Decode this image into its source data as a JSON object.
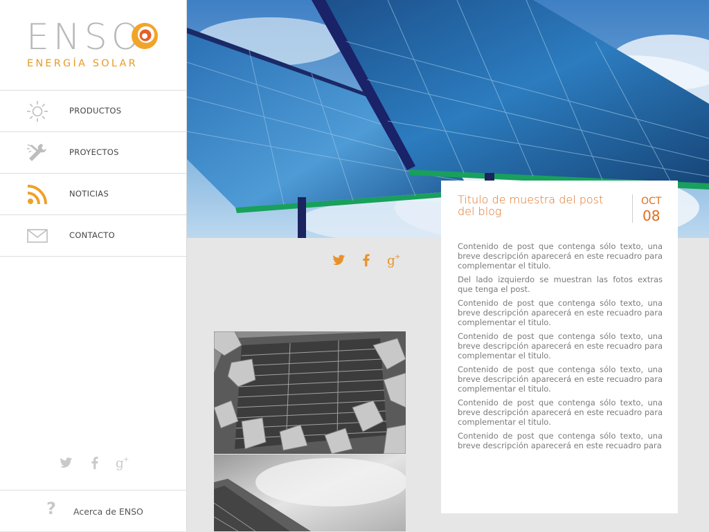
{
  "brand": {
    "name": "ENSO",
    "tagline": "ENERGÍA SOLAR",
    "accent": "#e89a27",
    "accent_dark": "#e06c1c"
  },
  "nav": [
    {
      "label": "PRODUCTOS",
      "icon": "sun-icon"
    },
    {
      "label": "PROYECTOS",
      "icon": "tools-icon"
    },
    {
      "label": "NOTICIAS",
      "icon": "rss-icon"
    },
    {
      "label": "CONTACTO",
      "icon": "mail-icon"
    }
  ],
  "sidebar_social": [
    "twitter-icon",
    "facebook-icon",
    "google-plus-icon"
  ],
  "about": {
    "label": "Acerca de ENSO",
    "icon": "question-icon"
  },
  "share": [
    "twitter-icon",
    "facebook-icon",
    "google-plus-icon"
  ],
  "post": {
    "title": "Titulo de muestra del post del blog",
    "month": "OCT",
    "day": "08",
    "paragraphs": [
      "Contenido de post que contenga sólo texto, una breve descripción aparecerá en este recuadro para complementar el titulo.",
      "Del lado izquierdo se muestran las fotos extras que tenga el post.",
      "Contenido de post que contenga sólo texto, una breve descripción aparecerá en este recuadro para complementar el titulo.",
      "Contenido de post que contenga sólo texto, una breve descripción aparecerá en este recuadro para complementar el titulo.",
      "Contenido de post que contenga sólo texto, una breve descripción aparecerá en este recuadro para complementar el titulo.",
      "Contenido de post que contenga sólo texto, una breve descripción aparecerá en este recuadro para complementar el titulo.",
      "Contenido de post que contenga sólo texto, una breve descripción aparecerá en este recuadro para"
    ]
  }
}
